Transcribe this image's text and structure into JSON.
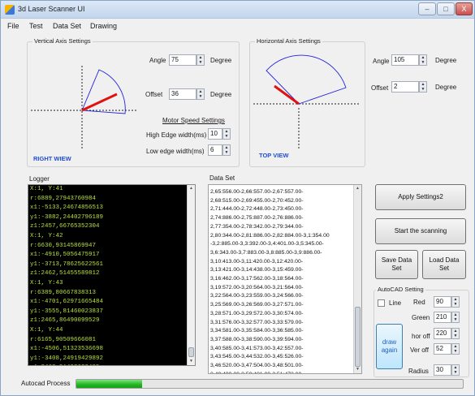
{
  "window": {
    "title": "3d Laser Scanner UI",
    "controls": [
      "–",
      "□",
      "X"
    ]
  },
  "menu": [
    "File",
    "Test",
    "Data Set",
    "Drawing"
  ],
  "vertical_axis": {
    "group_label": "Vertical Axis Settings",
    "angle_label": "Angle",
    "angle_value": "75",
    "offset_label": "Offset",
    "offset_value": "36",
    "unit": "Degree",
    "view_label": "RIGHT WIEW"
  },
  "motor_speed": {
    "title": "Motor Speed Settings",
    "high_label": "High Edge width(ms)",
    "high_value": "10",
    "low_label": "Low edge width(ms)",
    "low_value": "6"
  },
  "horizontal_axis": {
    "group_label": "Horizontal Axis Settings",
    "angle_label": "Angle",
    "angle_value": "105",
    "offset_label": "Offset",
    "offset_value": "2",
    "unit": "Degree",
    "view_label": "TOP VIEW"
  },
  "logger": {
    "label": "Logger",
    "lines": [
      "X:1, Y:41",
      "r:6889,27943760984",
      "x1:-5133,24674856513",
      "y1:-3882,24402796189",
      "z1:2457,66765352304",
      "X:1, Y:42",
      "r:6630,93145869947",
      "x1:-4910,5056475917",
      "y1:-3713,78625622561",
      "z1:2462,51455589812",
      "X:1, Y:43",
      "r:6389,80667838313",
      "x1:-4701,62971665484",
      "y1:-3555,81460023837",
      "z1:2465,86490099529",
      "X:1, Y:44",
      "r:6165,90509666081",
      "x1:-4506,51323536698",
      "y1:-3408,24919429892",
      "z1:2468,51403683485"
    ]
  },
  "dataset": {
    "label": "Data Set",
    "lines": [
      "2,65:556.00-2,66:557.00-2,67:557.00-",
      "2,68:515.00-2,69:455.00-2,70:452.00-",
      "2,71:444.00-2,72:448.00-2,73:450.00-",
      "2,74:886.00-2,75:887.00-2,76:886.00-",
      "2,77:354.00-2,78:342.00-2,79:344.00-",
      "2,80:344.00-2,81:886.00-2,82:884.00-3,1:354.00",
      "-3,2:885.00-3,3:392.00-3,4:401.00-3,5:345.00-",
      "3,6:343.00-3,7:883.00-3,8:885.00-3,9:886.00-",
      "3,10:413.00-3,11:420.00-3,12:420.00-",
      "3,13:421.00-3,14:438.00-3,15:459.00-",
      "3,16:462.00-3,17:562.00-3,18:564.00-",
      "3,19:572.00-3,20:564.00-3,21:564.00-",
      "3,22:564.00-3,23:559.00-3,24:566.00-",
      "3,25:569.00-3,26:569.00-3,27:571.00-",
      "3,28:571.00-3,29:572.00-3,30:574.00-",
      "3,31:576.00-3,32:577.00-3,33:579.00-",
      "3,34:581.00-3,35:584.00-3,36:585.00-",
      "3,37:588.00-3,38:590.00-3,39:594.00-",
      "3,40:585.00-3,41:573.00-3,42:557.00-",
      "3,43:545.00-3,44:532.00-3,45:526.00-",
      "3,46:520.00-3,47:504.00-3,48:501.00-",
      "3,49:490.00-3,50:481.00-3,51:472.00-",
      "3,52:465.00-3,53:455.00"
    ]
  },
  "buttons": {
    "apply": "Apply Settings2",
    "start": "Start the scanning",
    "save": "Save Data Set",
    "load": "Load Data Set",
    "draw": "draw again"
  },
  "autocad": {
    "group_label": "AutoCAD Setting",
    "line_label": "Line",
    "red_label": "Red",
    "red_value": "90",
    "green_label": "Green",
    "green_value": "210",
    "hor_label": "hor off",
    "hor_value": "220",
    "ver_label": "Ver off",
    "ver_value": "52",
    "radius_label": "Radius",
    "radius_value": "30"
  },
  "status": {
    "process_label": "Autocad Process",
    "progress_fraction": 0.17,
    "progress_color": "#22b422"
  }
}
